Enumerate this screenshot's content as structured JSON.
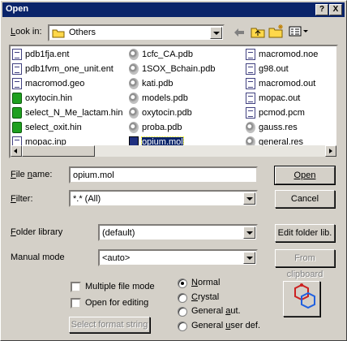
{
  "window": {
    "title": "Open",
    "help_label": "?",
    "close_label": "X"
  },
  "lookin": {
    "label": "Look in:",
    "value": "Others"
  },
  "files": [
    {
      "name": "pdb1fja.ent",
      "icon": "doc"
    },
    {
      "name": "pdb1fvm_one_unit.ent",
      "icon": "doc"
    },
    {
      "name": "macromod.geo",
      "icon": "doc"
    },
    {
      "name": "oxytocin.hin",
      "icon": "hin"
    },
    {
      "name": "select_N_Me_lactam.hin",
      "icon": "hin"
    },
    {
      "name": "select_oxit.hin",
      "icon": "hin"
    },
    {
      "name": "mopac.inp",
      "icon": "doc"
    },
    {
      "name": "1cfc_CA.pdb",
      "icon": "mol"
    },
    {
      "name": "1SOX_Bchain.pdb",
      "icon": "mol"
    },
    {
      "name": "kati.pdb",
      "icon": "mol"
    },
    {
      "name": "models.pdb",
      "icon": "mol"
    },
    {
      "name": "oxytocin.pdb",
      "icon": "mol"
    },
    {
      "name": "proba.pdb",
      "icon": "mol"
    },
    {
      "name": "opium.mol",
      "icon": "sel",
      "selected": true
    },
    {
      "name": "macromod.noe",
      "icon": "doc"
    },
    {
      "name": "g98.out",
      "icon": "doc"
    },
    {
      "name": "macromod.out",
      "icon": "doc"
    },
    {
      "name": "mopac.out",
      "icon": "doc"
    },
    {
      "name": "pcmod.pcm",
      "icon": "doc"
    },
    {
      "name": "gauss.res",
      "icon": "mol"
    },
    {
      "name": "general.res",
      "icon": "mol"
    }
  ],
  "form": {
    "filename_label": "File name:",
    "filename_value": "opium.mol",
    "filter_label": "Filter:",
    "filter_value": "*.* (All)",
    "folder_library_label": "Folder library",
    "folder_library_value": "(default)",
    "manual_mode_label": "Manual mode",
    "manual_mode_value": "<auto>"
  },
  "buttons": {
    "open": "Open",
    "cancel": "Cancel",
    "edit_folder_lib": "Edit folder lib.",
    "from_clipboard": "From clipboard",
    "select_format_string": "Select format string"
  },
  "checkboxes": {
    "multiple_file_mode": "Multiple file mode",
    "open_for_editing": "Open for editing"
  },
  "radios": {
    "normal": "Normal",
    "crystal": "Crystal",
    "general_aut": "General aut.",
    "general_user_def": "General user def."
  },
  "selected_radio": "normal",
  "colors": {
    "titlebar": "#0a246a",
    "face": "#d4d0c8",
    "selection": "#0a246a"
  }
}
